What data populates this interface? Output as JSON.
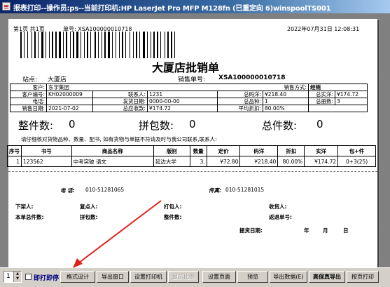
{
  "window": {
    "title": "报表打印--操作员:ps--当前打印机:HP LaserJet Pro MFP M128fn (已重定向 6)winspoolTS001"
  },
  "report": {
    "page_info": "第1页 共1页",
    "doc_no_header": "单号: XSA100000010718",
    "datetime": "2022年07月31日 12:08:31",
    "title": "大厦店批销单",
    "store_label": "站点:",
    "store": "大厦店",
    "sale_no_label": "销售单号:",
    "sale_no": "XSA100000010718",
    "info": {
      "customer_label": "客户:",
      "customer": "东宇集团",
      "sale_method_label": "销售方式:",
      "sale_method": "经销",
      "customer_code_label": "客户编号:",
      "customer_code": "KH02000009",
      "contact_label": "联系人:",
      "contact": "1231",
      "total_price_label": "总码洋:",
      "total_price": "¥218.40",
      "total_actual_label": "总实洋:",
      "total_actual": "¥174.72",
      "phone_label": "电话:",
      "phone": "",
      "ship_date_label": "发货日期:",
      "ship_date": "0000-00-00",
      "total_kinds_label": "总品种:",
      "total_kinds": "1",
      "total_volumes_label": "总册数:",
      "total_volumes": "3",
      "sale_date_label": "销售日期:",
      "sale_date": "2021-07-02",
      "total_due_label": "总应收款:",
      "total_due": "¥174.72",
      "avg_discount_label": "平均折扣:",
      "avg_discount": "80.00%"
    },
    "summary": {
      "whole_label": "整件数:",
      "whole": "0",
      "mixed_label": "拼包数:",
      "mixed": "0",
      "total_label": "总件数:",
      "total": "0"
    },
    "notice": "请仔细核对货物品种、数量、配书, 如有货物与单据不符请及时与我公司联系,联系人:",
    "table": {
      "headers": [
        "序号",
        "书号",
        "商品名称",
        "版别",
        "数量",
        "定价",
        "码洋",
        "折扣",
        "实洋",
        "包+件"
      ],
      "rows": [
        [
          "1",
          "123562",
          "中考突破 语文",
          "延边大学",
          "3.",
          "¥72.80",
          "¥218.40",
          "80.00%",
          "¥174.72",
          "0+3(25)"
        ]
      ]
    },
    "footer": {
      "phone_label": "电 话:",
      "phone": "010-51281065",
      "fax_label": "传真:",
      "fax": "010-51281015",
      "picker_label": "下架人:",
      "checker_label": "复点人:",
      "packer_label": "打包人:",
      "receiver_label": "收货人:",
      "total_items_label": "本单总件数:",
      "pack_count_label": "拼包数:",
      "whole_count_label": "整件数:",
      "return_no_label": "返退单号:",
      "pickup_label": "提货日期:",
      "year": "年",
      "month": "月",
      "day": "日"
    }
  },
  "toolbar": {
    "page_value": "1",
    "print_on_open_label": "即打即停",
    "buttons": [
      {
        "label": "格式设计",
        "disabled": false
      },
      {
        "label": "导出窗口",
        "disabled": false
      },
      {
        "label": "设置打印机",
        "disabled": false
      },
      {
        "label": "显示比例",
        "disabled": true
      },
      {
        "label": "设置页面",
        "disabled": false
      },
      {
        "label": "预览",
        "disabled": false
      },
      {
        "label": "导出数据(E)",
        "disabled": false
      },
      {
        "label": "高保真导出",
        "disabled": false,
        "bold": true
      },
      {
        "label": "按页打印",
        "disabled": false
      }
    ]
  },
  "annotation": {
    "arrow_color": "#e0201b"
  }
}
